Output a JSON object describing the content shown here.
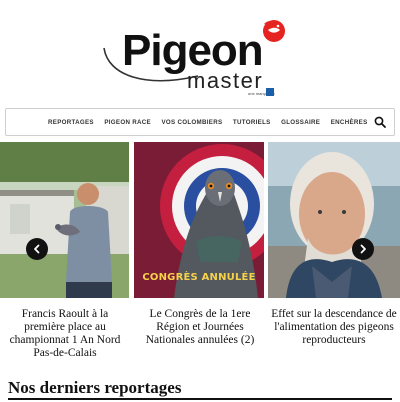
{
  "header": {
    "logo_word": "Pigeon",
    "logo_sub": "master",
    "tagline": "une marque de"
  },
  "nav": {
    "items": [
      {
        "label": "REPORTAGES"
      },
      {
        "label": "PIGEON RACE"
      },
      {
        "label": "VOS COLOMBIERS"
      },
      {
        "label": "TUTORIELS"
      },
      {
        "label": "GLOSSAIRE"
      },
      {
        "label": "ENCHÈRES"
      }
    ],
    "search_icon": "search-icon"
  },
  "slider": {
    "slides": [
      {
        "caption": "Francis Raoult à la première place au championnat 1 An Nord Pas-de-Calais"
      },
      {
        "caption": "Le Congrès de la 1ere Région et Journées Nationales annulées (2)",
        "overlay": "CONGRÈS ANNULÉE"
      },
      {
        "caption": "Effet sur la descendance de l'alimentation des pigeons reproducteurs"
      }
    ],
    "prev_icon": "chevron-left-icon",
    "next_icon": "chevron-right-icon"
  },
  "section": {
    "title": "Nos derniers reportages"
  },
  "colors": {
    "accent_red": "#e52421",
    "nav_text": "#333333",
    "arrow_bg": "#111111"
  }
}
